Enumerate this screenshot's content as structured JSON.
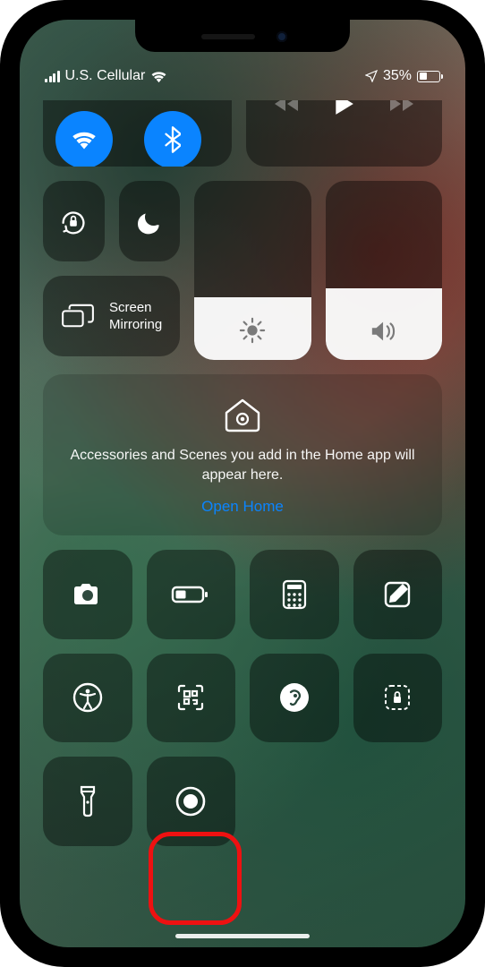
{
  "status": {
    "carrier": "U.S. Cellular",
    "battery_text": "35%"
  },
  "screen_mirroring": {
    "label_line1": "Screen",
    "label_line2": "Mirroring"
  },
  "home_card": {
    "message": "Accessories and Scenes you add in the Home app will appear here.",
    "link": "Open Home"
  },
  "highlight": {
    "target": "screen-recording-button"
  }
}
